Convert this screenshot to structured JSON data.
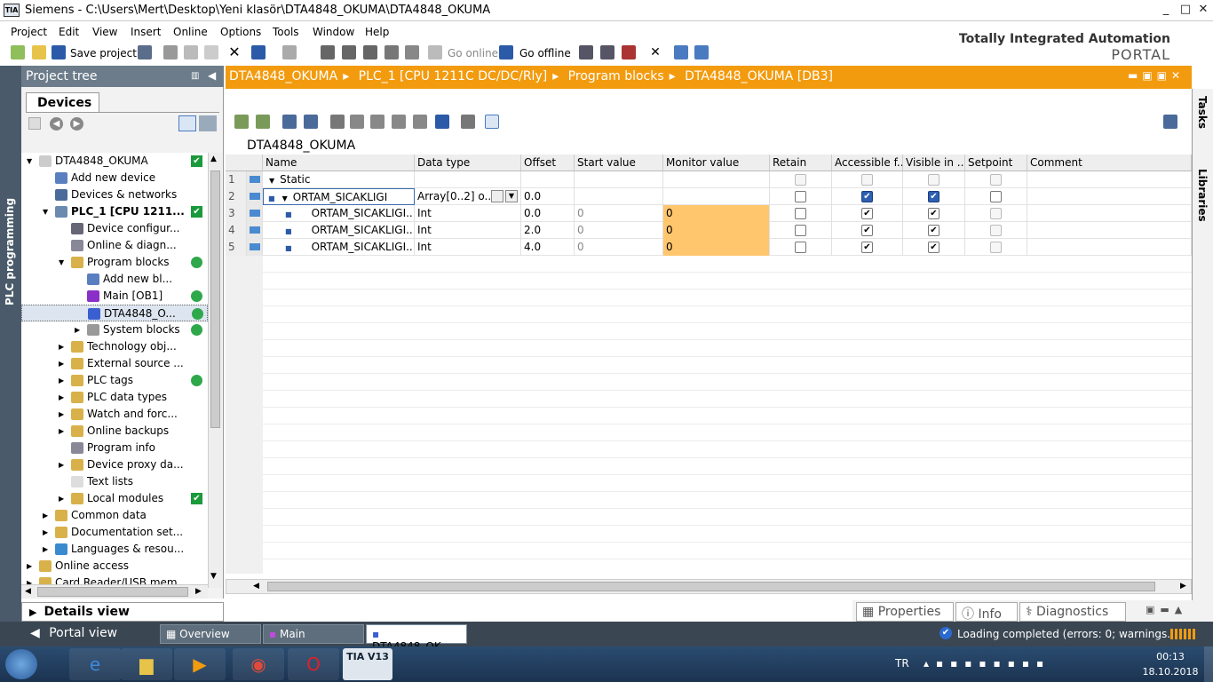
{
  "window": {
    "title": "Siemens  -  C:\\Users\\Mert\\Desktop\\Yeni klasör\\DTA4848_OKUMA\\DTA4848_OKUMA",
    "logo": "TIA"
  },
  "menu": [
    "Project",
    "Edit",
    "View",
    "Insert",
    "Online",
    "Options",
    "Tools",
    "Window",
    "Help"
  ],
  "toolbar": {
    "save": "Save project",
    "go_online": "Go online",
    "go_offline": "Go offline"
  },
  "brand": {
    "line1": "Totally Integrated Automation",
    "line2": "PORTAL"
  },
  "sidebar_tab": "PLC programming",
  "project_tree": {
    "header": "Project tree",
    "tab": "Devices",
    "items": [
      {
        "label": "DTA4848_OKUMA",
        "status": "check"
      },
      {
        "label": "Add new device"
      },
      {
        "label": "Devices & networks"
      },
      {
        "label": "PLC_1 [CPU 1211...",
        "status": "check"
      },
      {
        "label": "Device configur..."
      },
      {
        "label": "Online & diagn..."
      },
      {
        "label": "Program blocks",
        "status": "ok"
      },
      {
        "label": "Add new bl..."
      },
      {
        "label": "Main [OB1]",
        "status": "ok"
      },
      {
        "label": "DTA4848_O...",
        "status": "ok"
      },
      {
        "label": "System blocks",
        "status": "ok"
      },
      {
        "label": "Technology obj..."
      },
      {
        "label": "External source ..."
      },
      {
        "label": "PLC tags",
        "status": "ok"
      },
      {
        "label": "PLC data types"
      },
      {
        "label": "Watch and forc..."
      },
      {
        "label": "Online backups"
      },
      {
        "label": "Program info"
      },
      {
        "label": "Device proxy da..."
      },
      {
        "label": "Text lists"
      },
      {
        "label": "Local modules",
        "status": "check"
      },
      {
        "label": "Common data"
      },
      {
        "label": "Documentation set..."
      },
      {
        "label": "Languages & resou..."
      },
      {
        "label": "Online access"
      },
      {
        "label": "Card Reader/USB mem..."
      }
    ]
  },
  "details_view": "Details view",
  "breadcrumb": [
    "DTA4848_OKUMA",
    "PLC_1 [CPU 1211C DC/DC/Rly]",
    "Program blocks",
    "DTA4848_OKUMA [DB3]"
  ],
  "block_name": "DTA4848_OKUMA",
  "table": {
    "columns": [
      "Name",
      "Data type",
      "Offset",
      "Start value",
      "Monitor value",
      "Retain",
      "Accessible f...",
      "Visible in ...",
      "Setpoint",
      "Comment"
    ],
    "rows": [
      {
        "num": "1",
        "name": "Static",
        "type": "",
        "offset": "",
        "start": "",
        "monitor": "",
        "retain": false,
        "access": false,
        "visible": false,
        "setpoint": false
      },
      {
        "num": "2",
        "name": "ORTAM_SICAKLIGI",
        "type": "Array[0..2] o...",
        "offset": "0.0",
        "start": "",
        "monitor": "",
        "retain": false,
        "access": true,
        "visible": true,
        "setpoint": false
      },
      {
        "num": "3",
        "name": "ORTAM_SICAKLIGI...",
        "type": "Int",
        "offset": "0.0",
        "start": "0",
        "monitor": "0",
        "retain": false,
        "access": true,
        "visible": true,
        "setpoint": false
      },
      {
        "num": "4",
        "name": "ORTAM_SICAKLIGI...",
        "type": "Int",
        "offset": "2.0",
        "start": "0",
        "monitor": "0",
        "retain": false,
        "access": true,
        "visible": true,
        "setpoint": false
      },
      {
        "num": "5",
        "name": "ORTAM_SICAKLIGI...",
        "type": "Int",
        "offset": "4.0",
        "start": "0",
        "monitor": "0",
        "retain": false,
        "access": true,
        "visible": true,
        "setpoint": false
      }
    ]
  },
  "right_tabs": [
    "Tasks",
    "Libraries"
  ],
  "inspector_tabs": [
    "Properties",
    "Info",
    "Diagnostics"
  ],
  "bottom": {
    "portal_view": "Portal view",
    "tabs": [
      "Overview",
      "Main",
      "DTA4848_OK..."
    ],
    "status": "Loading completed (errors: 0; warnings..."
  },
  "taskbar": {
    "lang": "TR",
    "time": "00:13",
    "date": "18.10.2018",
    "tia_label": "TIA V13"
  }
}
